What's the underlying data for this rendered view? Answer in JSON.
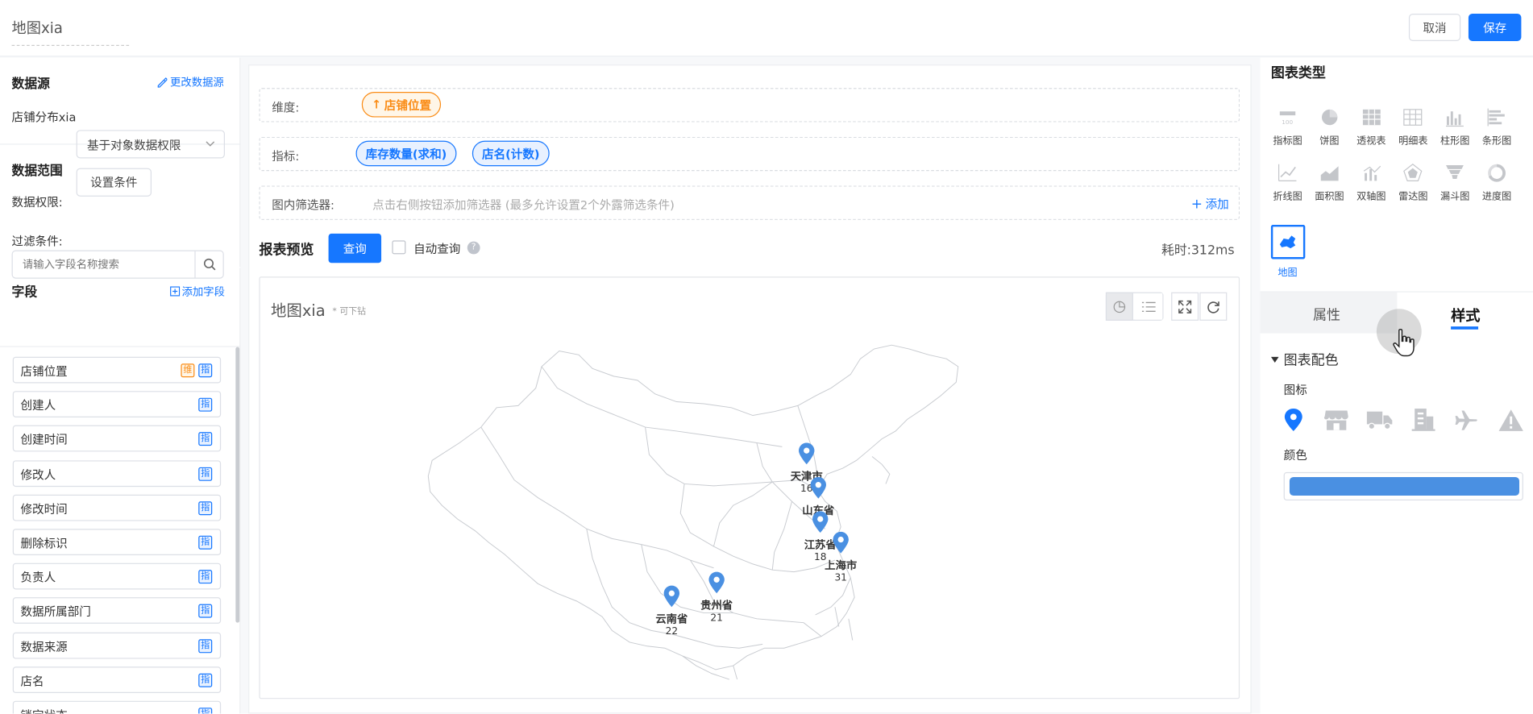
{
  "header": {
    "title": "地图xia",
    "cancel_label": "取消",
    "save_label": "保存"
  },
  "left": {
    "datasource_title": "数据源",
    "change_datasource": "更改数据源",
    "datasource_name": "店铺分布xia",
    "range_title": "数据范围",
    "permission_label": "数据权限:",
    "permission_value": "基于对象数据权限",
    "filter_label": "过滤条件:",
    "filter_button": "设置条件",
    "fields_title": "字段",
    "add_field": "添加字段",
    "search_placeholder": "请输入字段名称搜索",
    "fields": [
      {
        "label": "店铺位置",
        "tags": [
          "维",
          "指"
        ]
      },
      {
        "label": "创建人",
        "tags": [
          "指"
        ]
      },
      {
        "label": "创建时间",
        "tags": [
          "指"
        ]
      },
      {
        "label": "修改人",
        "tags": [
          "指"
        ]
      },
      {
        "label": "修改时间",
        "tags": [
          "指"
        ]
      },
      {
        "label": "删除标识",
        "tags": [
          "指"
        ]
      },
      {
        "label": "负责人",
        "tags": [
          "指"
        ]
      },
      {
        "label": "数据所属部门",
        "tags": [
          "指"
        ]
      },
      {
        "label": "数据来源",
        "tags": [
          "指"
        ]
      },
      {
        "label": "店名",
        "tags": [
          "指"
        ]
      },
      {
        "label": "锁定状态",
        "tags": [
          "指"
        ]
      }
    ]
  },
  "config": {
    "dimension_label": "维度:",
    "dimension_pill": "店铺位置",
    "metric_label": "指标:",
    "metric_pills": [
      "库存数量(求和)",
      "店名(计数)"
    ],
    "filter_label": "图内筛选器:",
    "filter_placeholder": "点击右侧按钮添加筛选器 (最多允许设置2个外露筛选条件)",
    "add_label": "添加"
  },
  "preview": {
    "title": "报表预览",
    "query_button": "查询",
    "auto_query": "自动查询",
    "elapsed": "耗时:312ms",
    "chart_title": "地图xia",
    "drill_hint": "* 可下钻"
  },
  "chart_data": {
    "type": "map",
    "title": "地图xia",
    "region": "China",
    "points": [
      {
        "name": "天津市",
        "value": 16
      },
      {
        "name": "山东省",
        "value": null
      },
      {
        "name": "江苏省",
        "value": 18
      },
      {
        "name": "上海市",
        "value": 31
      },
      {
        "name": "贵州省",
        "value": 21
      },
      {
        "name": "云南省",
        "value": 22
      }
    ],
    "marker_color": "#4a90e2"
  },
  "right": {
    "chart_type_title": "图表类型",
    "chart_types": [
      {
        "label": "指标图",
        "icon": "indicator-icon"
      },
      {
        "label": "饼图",
        "icon": "pie-icon"
      },
      {
        "label": "透视表",
        "icon": "pivot-table-icon"
      },
      {
        "label": "明细表",
        "icon": "detail-table-icon"
      },
      {
        "label": "柱形图",
        "icon": "column-chart-icon"
      },
      {
        "label": "条形图",
        "icon": "bar-chart-icon"
      },
      {
        "label": "折线图",
        "icon": "line-chart-icon"
      },
      {
        "label": "面积图",
        "icon": "area-chart-icon"
      },
      {
        "label": "双轴图",
        "icon": "dual-axis-icon"
      },
      {
        "label": "雷达图",
        "icon": "radar-icon"
      },
      {
        "label": "漏斗图",
        "icon": "funnel-icon"
      },
      {
        "label": "进度图",
        "icon": "progress-icon"
      },
      {
        "label": "地图",
        "icon": "map-icon",
        "selected": true
      }
    ],
    "tabs": [
      "属性",
      "样式"
    ],
    "active_tab": "样式",
    "section_title": "图表配色",
    "icon_label": "图标",
    "icons": [
      "location-pin-icon",
      "shop-icon",
      "truck-icon",
      "building-icon",
      "airplane-icon",
      "warning-icon"
    ],
    "color_label": "颜色",
    "color_value": "#4a90e2",
    "accent_color": "#1677ff"
  }
}
